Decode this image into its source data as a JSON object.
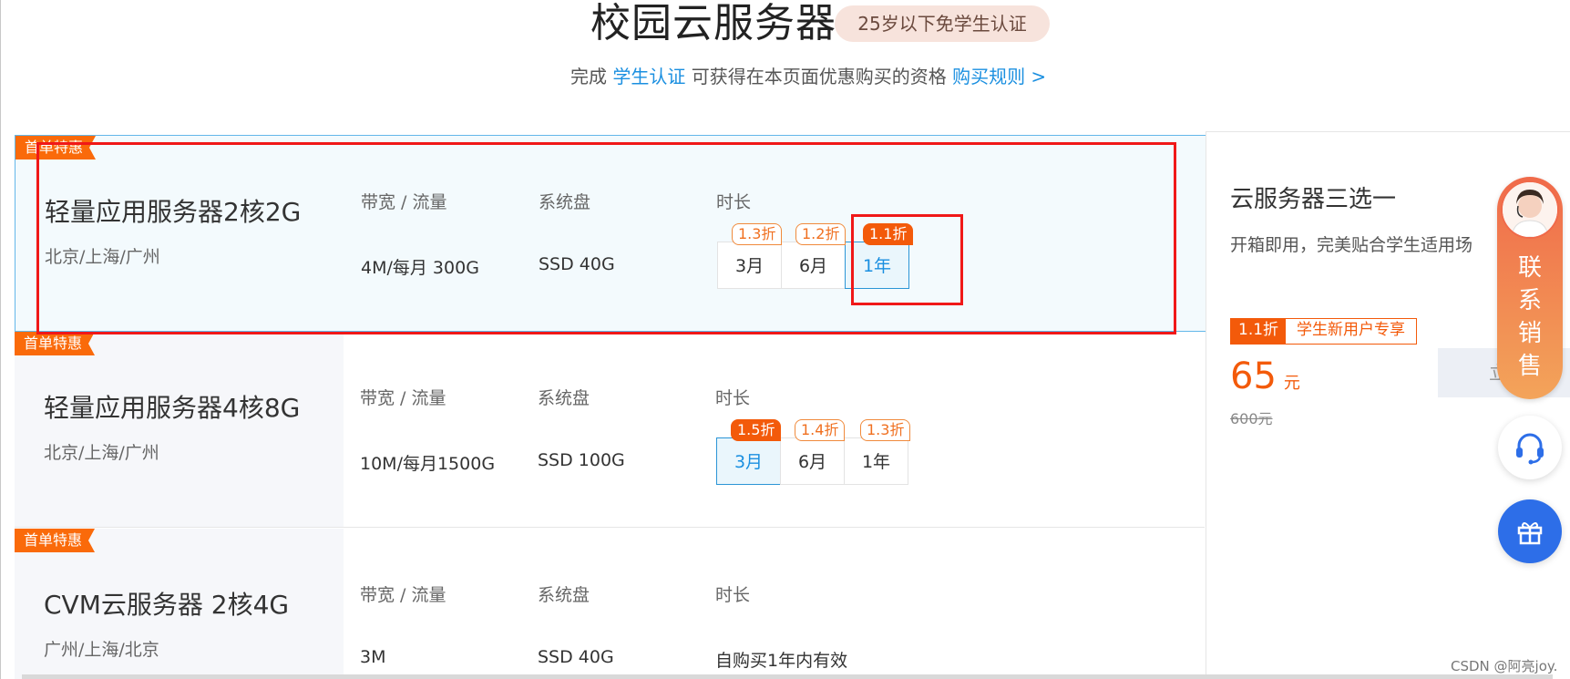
{
  "header": {
    "title": "校园云服务器",
    "age_badge": "25岁以下免学生认证",
    "sub_prefix": "完成",
    "sub_link": "学生认证",
    "sub_middle": "可获得在本页面优惠购买的资格",
    "rules_link": "购买规则 >"
  },
  "products": [
    {
      "tag": "首单特惠",
      "name": "轻量应用服务器2核2G",
      "regions": "北京/上海/广州",
      "bandwidth_label": "带宽 / 流量",
      "bandwidth": "4M/每月 300G",
      "disk_label": "系统盘",
      "disk": "SSD 40G",
      "duration_label": "时长",
      "durations": [
        {
          "label": "3月",
          "discount": "1.3折"
        },
        {
          "label": "6月",
          "discount": "1.2折"
        },
        {
          "label": "1年",
          "discount": "1.1折"
        }
      ],
      "selected_duration": "1年"
    },
    {
      "tag": "首单特惠",
      "name": "轻量应用服务器4核8G",
      "regions": "北京/上海/广州",
      "bandwidth_label": "带宽 / 流量",
      "bandwidth": "10M/每月1500G",
      "disk_label": "系统盘",
      "disk": "SSD 100G",
      "duration_label": "时长",
      "durations": [
        {
          "label": "3月",
          "discount": "1.5折"
        },
        {
          "label": "6月",
          "discount": "1.4折"
        },
        {
          "label": "1年",
          "discount": "1.3折"
        }
      ],
      "selected_duration": "3月"
    },
    {
      "tag": "首单特惠",
      "name": "CVM云服务器 2核4G",
      "regions": "广州/上海/北京",
      "bandwidth_label": "带宽 / 流量",
      "bandwidth": "3M",
      "disk_label": "系统盘",
      "disk": "SSD 40G",
      "duration_label": "时长",
      "duration_text": "自购买1年内有效"
    }
  ],
  "panel": {
    "title": "云服务器三选一",
    "desc": "开箱即用，完美贴合学生适用场",
    "badge_discount": "1.1折",
    "badge_text": "学生新用户专享",
    "price": "65",
    "unit": "元",
    "original_price": "600元",
    "buy_button": "立"
  },
  "widgets": {
    "sales_text": "联系销售",
    "sales_chars": [
      "联",
      "系",
      "销",
      "售"
    ]
  },
  "watermark": "CSDN @阿亮joy.",
  "colors": {
    "accent_orange": "#f35a0a",
    "link_blue": "#1a8fe0",
    "selected_border": "#2b95d6",
    "annotation_red": "#f01818"
  }
}
